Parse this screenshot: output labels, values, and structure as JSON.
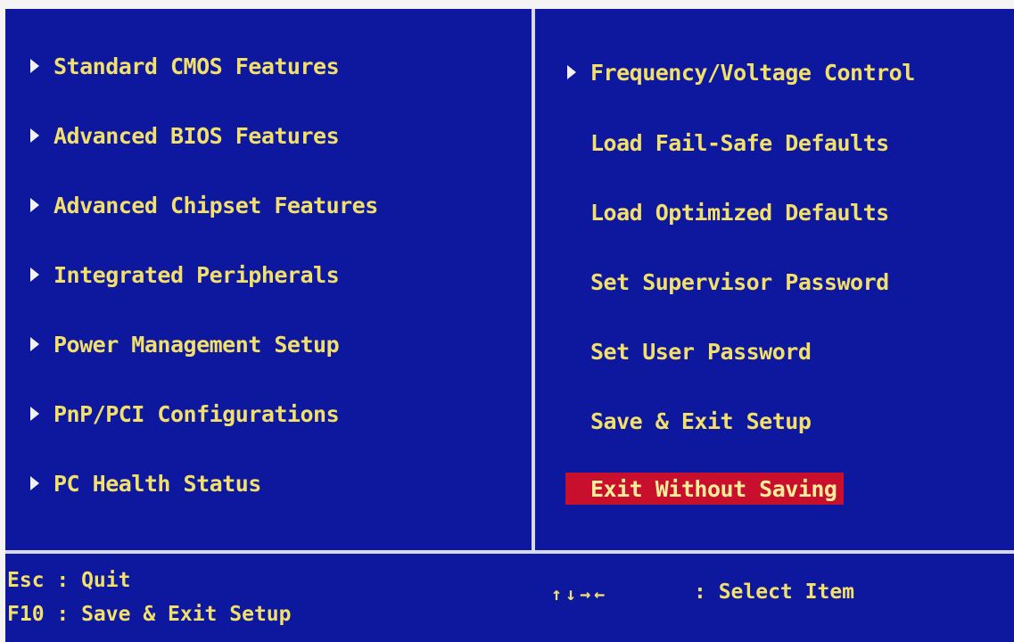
{
  "left_menu": [
    {
      "label": "Standard CMOS Features",
      "submenu": true
    },
    {
      "label": "Advanced BIOS Features",
      "submenu": true
    },
    {
      "label": "Advanced Chipset Features",
      "submenu": true
    },
    {
      "label": "Integrated Peripherals",
      "submenu": true
    },
    {
      "label": "Power Management Setup",
      "submenu": true
    },
    {
      "label": "PnP/PCI Configurations",
      "submenu": true
    },
    {
      "label": "PC Health Status",
      "submenu": true
    }
  ],
  "right_menu": [
    {
      "label": "Frequency/Voltage Control",
      "submenu": true
    },
    {
      "label": "Load Fail-Safe Defaults",
      "submenu": false
    },
    {
      "label": "Load Optimized Defaults",
      "submenu": false
    },
    {
      "label": "Set Supervisor Password",
      "submenu": false
    },
    {
      "label": "Set User Password",
      "submenu": false
    },
    {
      "label": "Save & Exit Setup",
      "submenu": false
    },
    {
      "label": "Exit Without Saving",
      "submenu": false,
      "selected": true
    }
  ],
  "footer": {
    "esc_hint": "Esc : Quit",
    "f10_hint": "F10 : Save & Exit Setup",
    "nav_keys": "↑↓→←",
    "select_hint": ": Select Item"
  },
  "colors": {
    "background": "#0d189f",
    "text": "#f2e06a",
    "highlight": "#c8102e",
    "divider": "#d8d8e8"
  }
}
